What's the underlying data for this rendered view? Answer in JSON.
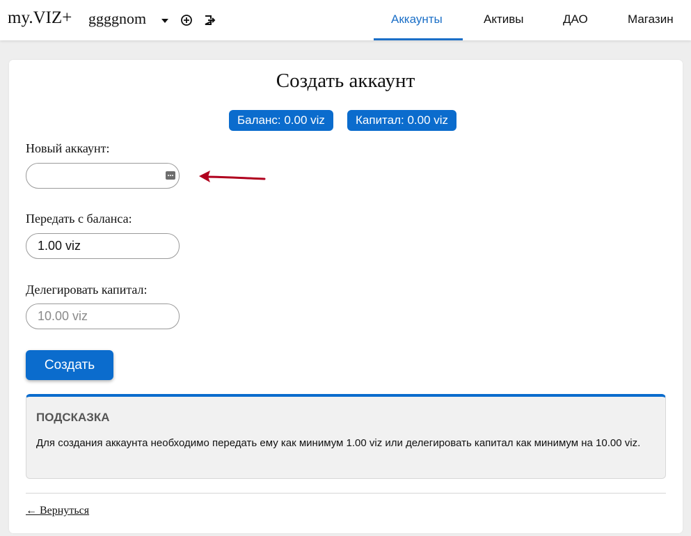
{
  "header": {
    "brand": "my.VIZ+",
    "username": "ggggnom",
    "icons": [
      "chevron-down-icon",
      "add-circle-icon",
      "logout-icon"
    ],
    "nav": [
      {
        "label": "Аккаунты",
        "active": true
      },
      {
        "label": "Активы",
        "active": false
      },
      {
        "label": "ДАО",
        "active": false
      },
      {
        "label": "Магазин",
        "active": false
      }
    ]
  },
  "page": {
    "title": "Создать аккаунт",
    "balance_badge": "Баланс: 0.00 viz",
    "capital_badge": "Капитал: 0.00 viz"
  },
  "form": {
    "new_account": {
      "label": "Новый аккаунт:",
      "value": "",
      "placeholder": ""
    },
    "transfer": {
      "label": "Передать с баланса:",
      "value": "1.00 viz",
      "placeholder": ""
    },
    "delegate": {
      "label": "Делегировать капитал:",
      "value": "",
      "placeholder": "10.00 viz"
    },
    "submit_label": "Создать"
  },
  "hint": {
    "title": "ПОДСКАЗКА",
    "text": "Для создания аккаунта необходимо передать ему как минимум 1.00 viz или делегировать капитал как минимум на 10.00 viz."
  },
  "footer": {
    "back_label": "← Вернуться"
  },
  "colors": {
    "accent": "#0b6ccd",
    "arrow": "#b0001e",
    "background": "#eeeeee"
  }
}
